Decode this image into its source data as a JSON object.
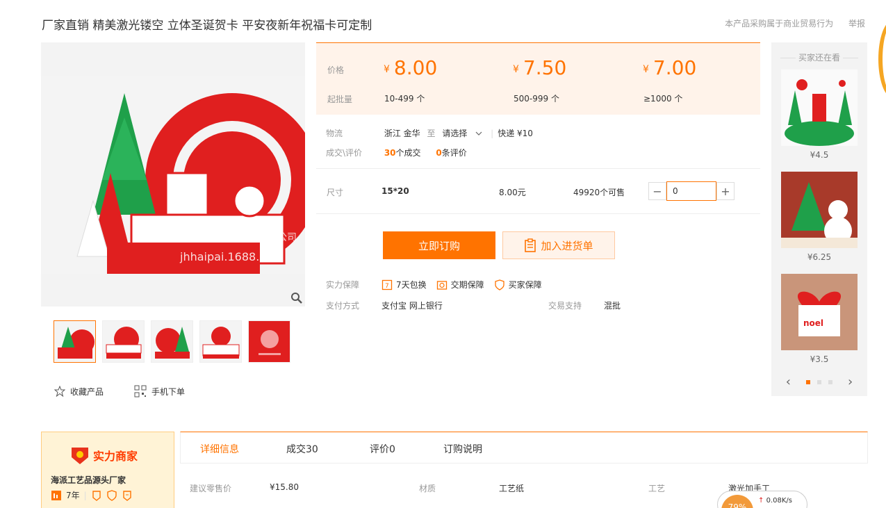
{
  "header": {
    "title": "厂家直销 精美激光镂空 立体圣诞贺卡 平安夜新年祝福卡可定制",
    "notice": "本产品采购属于商业贸易行为",
    "report": "举报"
  },
  "price": {
    "price_label": "价格",
    "moq_label": "起批量",
    "currency": "¥",
    "tiers": [
      {
        "price": "8.00",
        "qty": "10-499 个"
      },
      {
        "price": "7.50",
        "qty": "500-999 个"
      },
      {
        "price": "7.00",
        "qty": "≥1000 个"
      }
    ]
  },
  "logistics": {
    "label": "物流",
    "origin": "浙江 金华",
    "to": "至",
    "dest": "请选择",
    "express": "快递 ¥10"
  },
  "deals": {
    "label": "成交\\评价",
    "count": "30",
    "count_suffix": "个成交",
    "reviews": "0",
    "reviews_suffix": "条评价"
  },
  "spec": {
    "label": "尺寸",
    "size": "15*20",
    "price": "8.00元",
    "stock": "49920个可售",
    "minus": "−",
    "plus": "+",
    "quantity": "0"
  },
  "actions": {
    "buy": "立即订购",
    "cart": "加入进货单"
  },
  "guarantee": {
    "label": "实力保障",
    "items": [
      "7天包换",
      "交期保障",
      "买家保障"
    ]
  },
  "payment": {
    "label": "支付方式",
    "methods": "支付宝   网上银行",
    "trade_label": "交易支持",
    "trade": "混批"
  },
  "gallery": {
    "watermark_line1": "金华市海派工艺品有限公司",
    "watermark_line2": "jhhaipai.1688.com",
    "favorite": "收藏产品",
    "mobile": "手机下单"
  },
  "sidebar": {
    "title": "买家还在看",
    "items": [
      {
        "price": "¥4.5"
      },
      {
        "price": "¥6.25"
      },
      {
        "price": "¥3.5"
      }
    ],
    "nav_prev": "‹",
    "nav_next": "›"
  },
  "merchant": {
    "badge": "实力商家",
    "name": "海派工艺品源头厂家",
    "years": "7年"
  },
  "tabs": [
    "详细信息",
    "成交30",
    "评价0",
    "订购说明"
  ],
  "attributes": [
    {
      "label": "建议零售价",
      "value": "¥15.80"
    },
    {
      "label": "材质",
      "value": "工艺纸"
    },
    {
      "label": "工艺",
      "value": "激光加手工"
    }
  ],
  "widget": {
    "percent": "79%",
    "speed": "0.08K/s"
  },
  "colors": {
    "accent": "#ff7300",
    "price_bg": "#fff3ea",
    "christmas_red": "#e01f1f",
    "christmas_green": "#1fa04a"
  }
}
